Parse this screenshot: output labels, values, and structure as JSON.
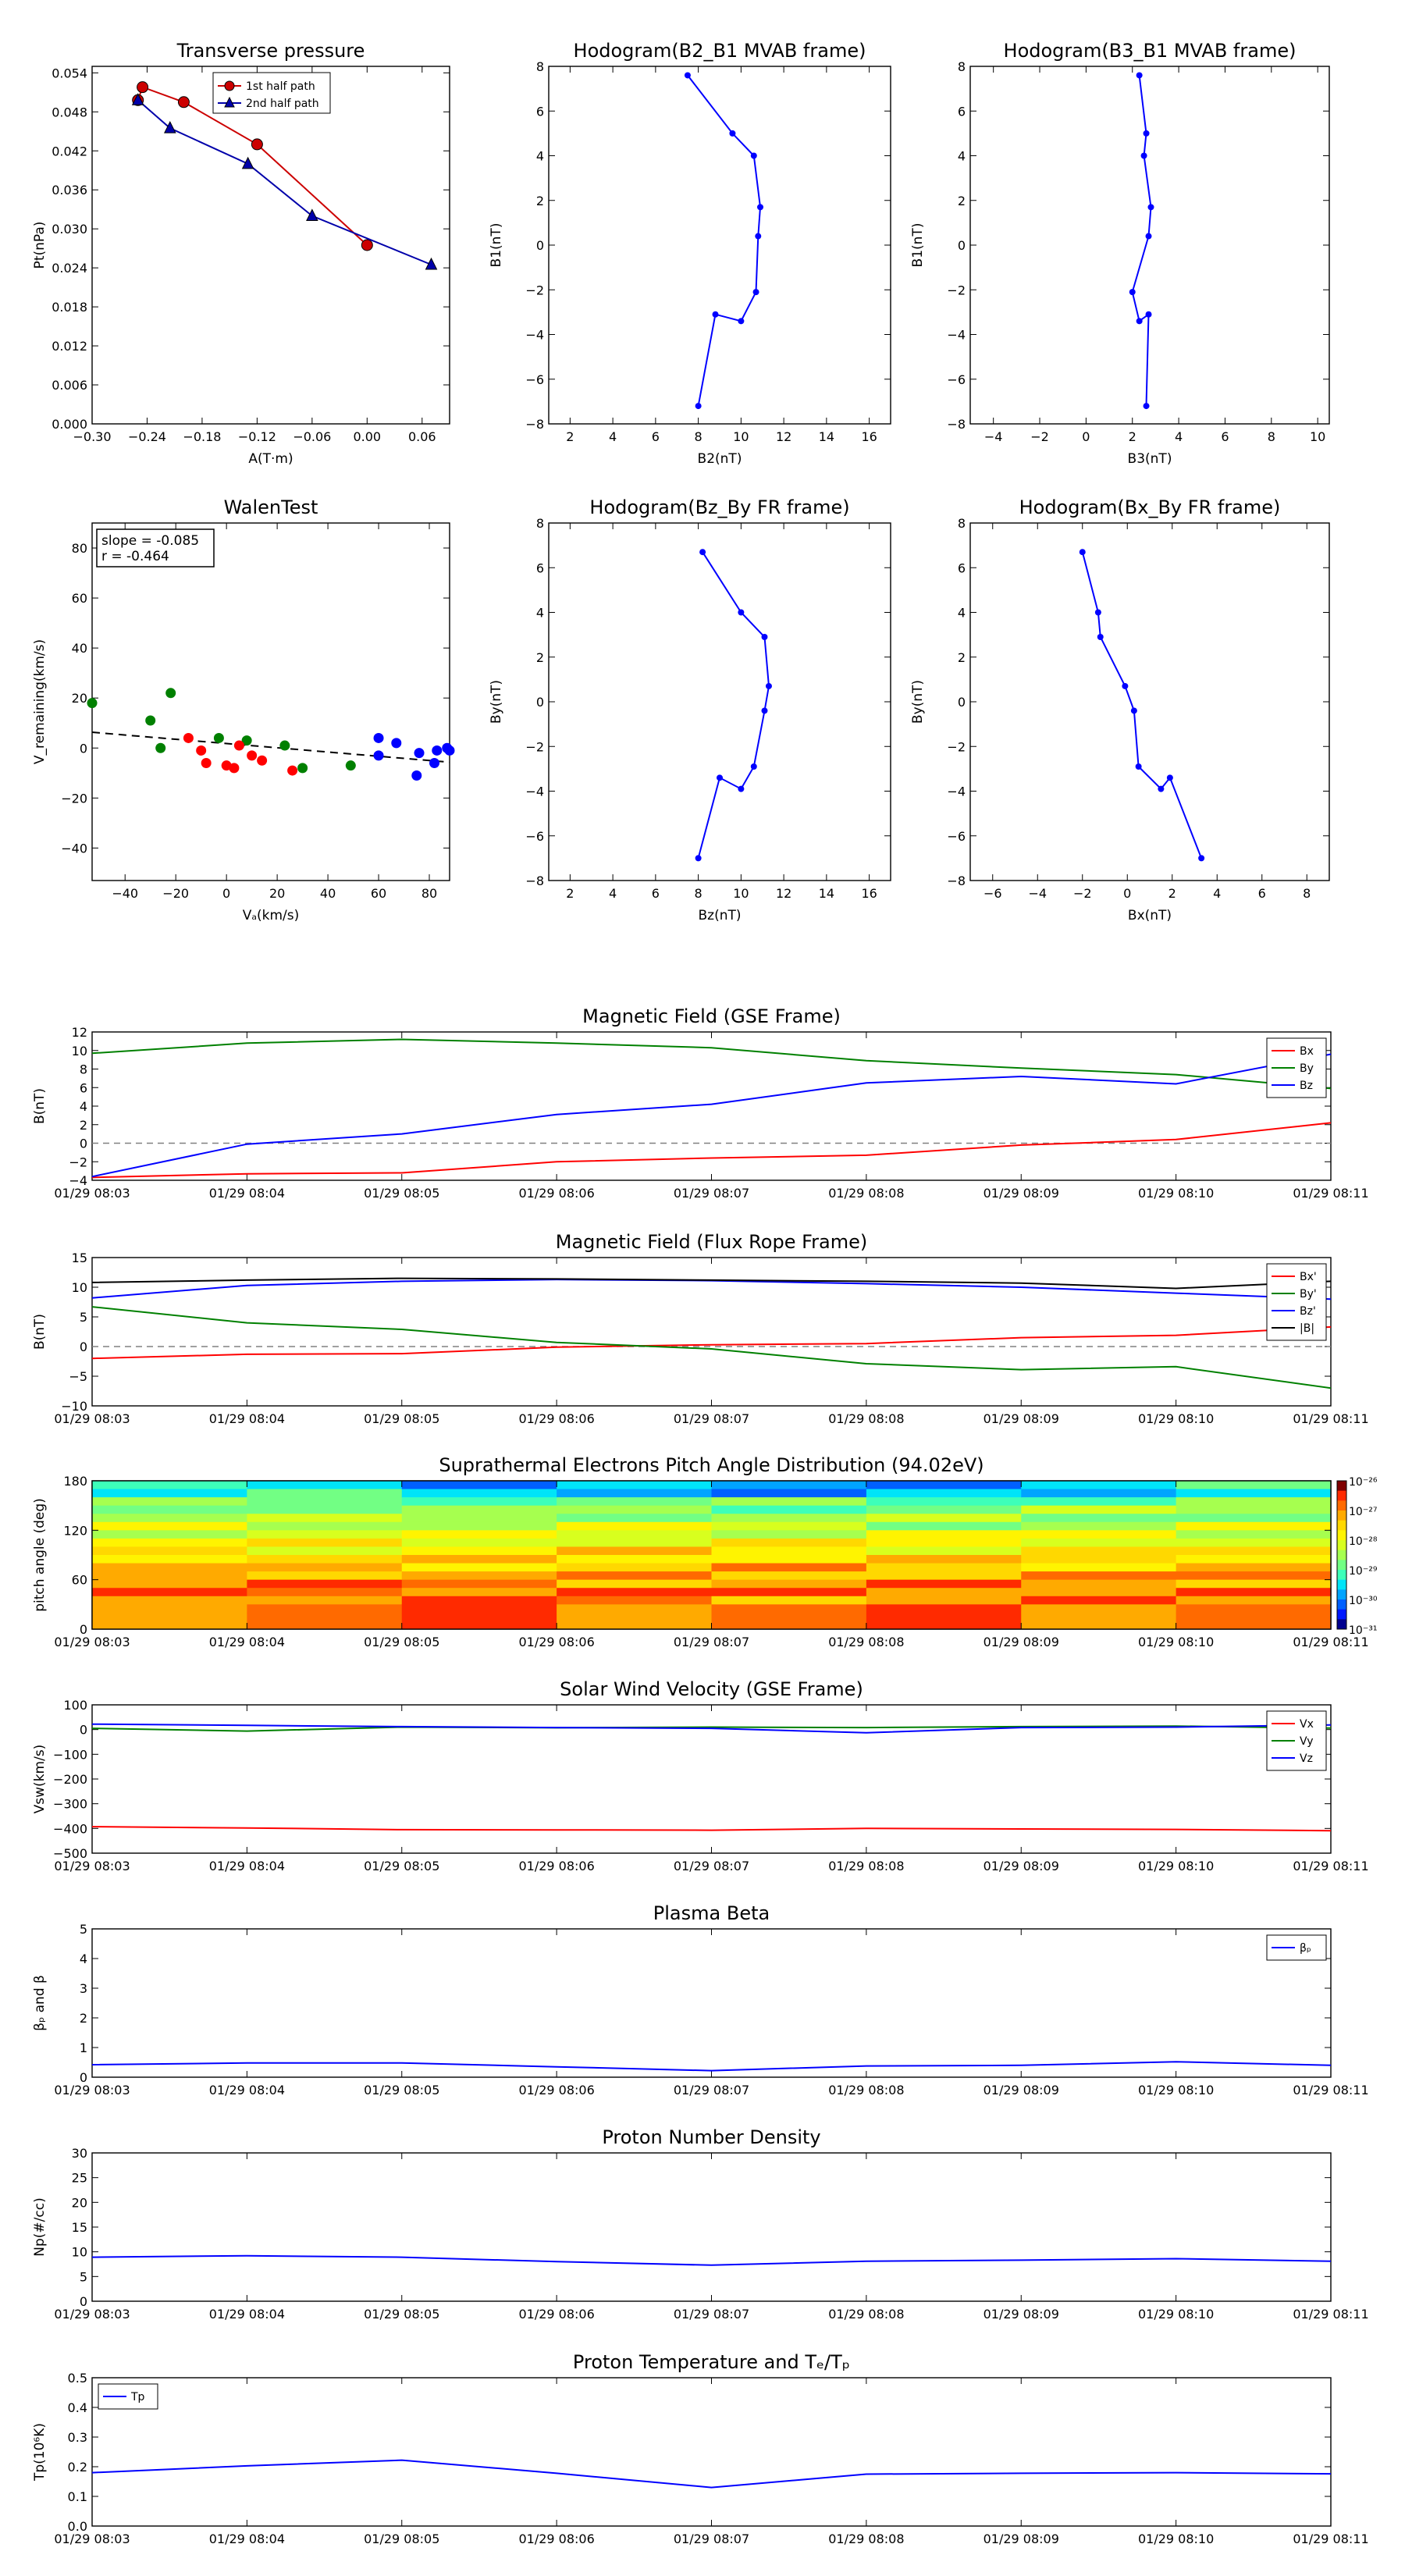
{
  "time_ticks": [
    "01/29 08:03",
    "01/29 08:04",
    "01/29 08:05",
    "01/29 08:06",
    "01/29 08:07",
    "01/29 08:08",
    "01/29 08:09",
    "01/29 08:10",
    "01/29 08:11"
  ],
  "colors": {
    "red": "#ff0000",
    "green": "#008000",
    "blue": "#0000ff",
    "darkred": "#cc0000",
    "navy": "#0000aa",
    "black": "#000000",
    "gray": "#808080"
  },
  "chart_data": [
    {
      "id": "tp",
      "type": "line",
      "title": "Transverse pressure",
      "xlabel": "A(T·m)",
      "ylabel": "Pt(nPa)",
      "xlim": [
        -0.3,
        0.09
      ],
      "ylim": [
        0.0,
        0.055
      ],
      "xticks": [
        -0.3,
        -0.24,
        -0.18,
        -0.12,
        -0.06,
        0.0,
        0.06
      ],
      "xtick_labels": [
        "−0.30",
        "−0.24",
        "−0.18",
        "−0.12",
        "−0.06",
        "0.00",
        "0.06"
      ],
      "yticks": [
        0.0,
        0.006,
        0.012,
        0.018,
        0.024,
        0.03,
        0.036,
        0.042,
        0.048,
        0.054
      ],
      "ytick_labels": [
        "0.000",
        "0.006",
        "0.012",
        "0.018",
        "0.024",
        "0.030",
        "0.036",
        "0.042",
        "0.048",
        "0.054"
      ],
      "legend": "upper-center",
      "series": [
        {
          "name": "1st half path",
          "marker": "circle",
          "color": "#cc0000",
          "x": [
            0.0,
            -0.12,
            -0.2,
            -0.245,
            -0.25
          ],
          "y": [
            0.0275,
            0.043,
            0.0495,
            0.0518,
            0.0498
          ]
        },
        {
          "name": "2nd half path",
          "marker": "triangle",
          "color": "#0000aa",
          "x": [
            -0.25,
            -0.215,
            -0.13,
            -0.06,
            0.07
          ],
          "y": [
            0.0498,
            0.0455,
            0.04,
            0.032,
            0.0245
          ]
        }
      ]
    },
    {
      "id": "h1",
      "type": "line",
      "title": "Hodogram(B2_B1 MVAB frame)",
      "xlabel": "B2(nT)",
      "ylabel": "B1(nT)",
      "xlim": [
        1,
        17
      ],
      "ylim": [
        -8,
        8
      ],
      "xticks": [
        2,
        4,
        6,
        8,
        10,
        12,
        14,
        16
      ],
      "yticks": [
        -8,
        -6,
        -4,
        -2,
        0,
        2,
        4,
        6,
        8
      ],
      "series": [
        {
          "color": "#0000ff",
          "x": [
            7.5,
            9.6,
            10.6,
            10.9,
            10.8,
            10.7,
            10.0,
            8.8,
            8.0
          ],
          "y": [
            7.6,
            5.0,
            4.0,
            1.7,
            0.4,
            -2.1,
            -3.4,
            -3.1,
            -7.2
          ]
        }
      ]
    },
    {
      "id": "h2",
      "type": "line",
      "title": "Hodogram(B3_B1 MVAB frame)",
      "xlabel": "B3(nT)",
      "ylabel": "B1(nT)",
      "xlim": [
        -5,
        10.5
      ],
      "ylim": [
        -8,
        8
      ],
      "xticks": [
        -4,
        -2,
        0,
        2,
        4,
        6,
        8,
        10
      ],
      "yticks": [
        -8,
        -6,
        -4,
        -2,
        0,
        2,
        4,
        6,
        8
      ],
      "series": [
        {
          "color": "#0000ff",
          "x": [
            2.3,
            2.6,
            2.5,
            2.8,
            2.7,
            2.0,
            2.3,
            2.7,
            2.6
          ],
          "y": [
            7.6,
            5.0,
            4.0,
            1.7,
            0.4,
            -2.1,
            -3.4,
            -3.1,
            -7.2
          ]
        }
      ]
    },
    {
      "id": "walen",
      "type": "scatter",
      "title": "WalenTest",
      "xlabel": "Vₐ(km/s)",
      "ylabel": "V_remaining(km/s)",
      "xlim": [
        -53,
        88
      ],
      "ylim": [
        -53,
        90
      ],
      "xticks": [
        -40,
        -20,
        0,
        20,
        40,
        60,
        80
      ],
      "yticks": [
        -40,
        -20,
        0,
        20,
        40,
        60,
        80
      ],
      "annotation": [
        "slope = -0.085",
        "r = -0.464"
      ],
      "fit": {
        "slope": -0.085,
        "intercept": 1.8
      },
      "series": [
        {
          "color": "#008000",
          "x": [
            -53,
            -30,
            -22,
            -26,
            -3,
            8,
            23,
            30,
            49
          ],
          "y": [
            18,
            11,
            22,
            0,
            4,
            3,
            1,
            -8,
            -7
          ]
        },
        {
          "color": "#ff0000",
          "x": [
            -15,
            -10,
            -8,
            0,
            3,
            5,
            10,
            14,
            26
          ],
          "y": [
            4,
            -1,
            -6,
            -7,
            -8,
            1,
            -3,
            -5,
            -9
          ]
        },
        {
          "color": "#0000ff",
          "x": [
            60,
            67,
            60,
            76,
            75,
            82,
            83,
            88,
            87
          ],
          "y": [
            4,
            2,
            -3,
            -2,
            -11,
            -6,
            -1,
            -1,
            0
          ]
        }
      ]
    },
    {
      "id": "h3",
      "type": "line",
      "title": "Hodogram(Bz_By FR frame)",
      "xlabel": "Bz(nT)",
      "ylabel": "By(nT)",
      "xlim": [
        1,
        17
      ],
      "ylim": [
        -8,
        8
      ],
      "xticks": [
        2,
        4,
        6,
        8,
        10,
        12,
        14,
        16
      ],
      "yticks": [
        -8,
        -6,
        -4,
        -2,
        0,
        2,
        4,
        6,
        8
      ],
      "series": [
        {
          "color": "#0000ff",
          "x": [
            8.2,
            10.0,
            11.1,
            11.3,
            11.1,
            10.6,
            10.0,
            9.0,
            8.0
          ],
          "y": [
            6.7,
            4.0,
            2.9,
            0.7,
            -0.4,
            -2.9,
            -3.9,
            -3.4,
            -7.0
          ]
        }
      ]
    },
    {
      "id": "h4",
      "type": "line",
      "title": "Hodogram(Bx_By FR frame)",
      "xlabel": "Bx(nT)",
      "ylabel": "By(nT)",
      "xlim": [
        -7,
        9
      ],
      "ylim": [
        -8,
        8
      ],
      "xticks": [
        -6,
        -4,
        -2,
        0,
        2,
        4,
        6,
        8
      ],
      "yticks": [
        -8,
        -6,
        -4,
        -2,
        0,
        2,
        4,
        6,
        8
      ],
      "series": [
        {
          "color": "#0000ff",
          "x": [
            -2.0,
            -1.3,
            -1.2,
            -0.1,
            0.3,
            0.5,
            1.5,
            1.9,
            3.3
          ],
          "y": [
            6.7,
            4.0,
            2.9,
            0.7,
            -0.4,
            -2.9,
            -3.9,
            -3.4,
            -7.0
          ]
        }
      ]
    },
    {
      "id": "mgse",
      "type": "line",
      "title": "Magnetic Field (GSE Frame)",
      "ylabel": "B(nT)",
      "ylim": [
        -4,
        12
      ],
      "yticks": [
        -4,
        -2,
        0,
        2,
        4,
        6,
        8,
        10,
        12
      ],
      "legend": "upper-right",
      "zero_line": true,
      "series": [
        {
          "name": "Bx",
          "color": "#ff0000",
          "y": [
            -3.7,
            -3.3,
            -3.2,
            -2.0,
            -1.6,
            -1.3,
            -0.2,
            0.4,
            2.2
          ]
        },
        {
          "name": "By",
          "color": "#008000",
          "y": [
            9.7,
            10.8,
            11.2,
            10.8,
            10.3,
            8.9,
            8.1,
            7.4,
            5.9
          ]
        },
        {
          "name": "Bz",
          "color": "#0000ff",
          "y": [
            -3.6,
            -0.1,
            1.0,
            3.1,
            4.2,
            6.5,
            7.2,
            6.4,
            9.6
          ]
        }
      ]
    },
    {
      "id": "mfr",
      "type": "line",
      "title": "Magnetic Field (Flux Rope Frame)",
      "ylabel": "B(nT)",
      "ylim": [
        -10,
        15
      ],
      "yticks": [
        -10,
        -5,
        0,
        5,
        10,
        15
      ],
      "legend": "upper-right",
      "zero_line": true,
      "series": [
        {
          "name": "Bx'",
          "color": "#ff0000",
          "y": [
            -2.0,
            -1.3,
            -1.2,
            -0.1,
            0.3,
            0.5,
            1.5,
            1.9,
            3.3
          ]
        },
        {
          "name": "By'",
          "color": "#008000",
          "y": [
            6.7,
            4.0,
            2.9,
            0.7,
            -0.4,
            -2.9,
            -3.9,
            -3.4,
            -7.0
          ]
        },
        {
          "name": "Bz'",
          "color": "#0000ff",
          "y": [
            8.2,
            10.3,
            11.0,
            11.3,
            11.1,
            10.6,
            10.0,
            9.0,
            8.0
          ]
        },
        {
          "name": "|B|",
          "color": "#000000",
          "y": [
            10.8,
            11.2,
            11.5,
            11.4,
            11.2,
            11.0,
            10.7,
            9.8,
            11.0
          ]
        }
      ]
    },
    {
      "id": "pad",
      "type": "heatmap",
      "title": "Suprathermal Electrons Pitch Angle Distribution (94.02eV)",
      "ylabel": "pitch angle (deg)",
      "ylim": [
        0,
        180
      ],
      "yticks": [
        0,
        60,
        120,
        180
      ],
      "colorbar_ticks": [
        "10⁻²⁶",
        "10⁻²⁷",
        "10⁻²⁸",
        "10⁻²⁹",
        "10⁻³⁰",
        "10⁻³¹"
      ],
      "bins": 18
    },
    {
      "id": "vsw",
      "type": "line",
      "title": "Solar Wind Velocity (GSE Frame)",
      "ylabel": "Vsw(km/s)",
      "ylim": [
        -500,
        100
      ],
      "yticks": [
        -500,
        -400,
        -300,
        -200,
        -100,
        0,
        100
      ],
      "legend": "upper-right",
      "series": [
        {
          "name": "Vx",
          "color": "#ff0000",
          "y": [
            -393,
            -398,
            -405,
            -406,
            -407,
            -400,
            -402,
            -404,
            -409
          ]
        },
        {
          "name": "Vy",
          "color": "#008000",
          "y": [
            5,
            -6,
            10,
            7,
            10,
            8,
            12,
            14,
            6
          ]
        },
        {
          "name": "Vz",
          "color": "#0000ff",
          "y": [
            22,
            17,
            12,
            8,
            5,
            -13,
            8,
            10,
            19
          ]
        }
      ]
    },
    {
      "id": "beta",
      "type": "line",
      "title": "Plasma Beta",
      "ylabel": "βₚ and β",
      "ylim": [
        0,
        5
      ],
      "yticks": [
        0,
        1,
        2,
        3,
        4,
        5
      ],
      "legend": "upper-right",
      "series": [
        {
          "name": "βₚ",
          "color": "#0000ff",
          "y": [
            0.42,
            0.48,
            0.48,
            0.35,
            0.22,
            0.38,
            0.4,
            0.52,
            0.4
          ]
        }
      ]
    },
    {
      "id": "np",
      "type": "line",
      "title": "Proton Number Density",
      "ylabel": "Np(#/cc)",
      "ylim": [
        0,
        30
      ],
      "yticks": [
        0,
        5,
        10,
        15,
        20,
        25,
        30
      ],
      "series": [
        {
          "name": "Np",
          "color": "#0000ff",
          "y": [
            8.9,
            9.2,
            8.9,
            8.0,
            7.3,
            8.1,
            8.3,
            8.6,
            8.1
          ]
        }
      ]
    },
    {
      "id": "tpp",
      "type": "line",
      "title": "Proton Temperature and Tₑ/Tₚ",
      "ylabel": "Tp(10⁶K)",
      "ylim": [
        0,
        0.5
      ],
      "yticks": [
        0,
        0.1,
        0.2,
        0.3,
        0.4,
        0.5
      ],
      "ytick_labels": [
        "0.0",
        "0.1",
        "0.2",
        "0.3",
        "0.4",
        "0.5"
      ],
      "legend": "upper-left",
      "series": [
        {
          "name": "Tp",
          "color": "#0000ff",
          "y": [
            0.18,
            0.203,
            0.222,
            0.178,
            0.13,
            0.175,
            0.178,
            0.18,
            0.176
          ]
        }
      ]
    }
  ]
}
